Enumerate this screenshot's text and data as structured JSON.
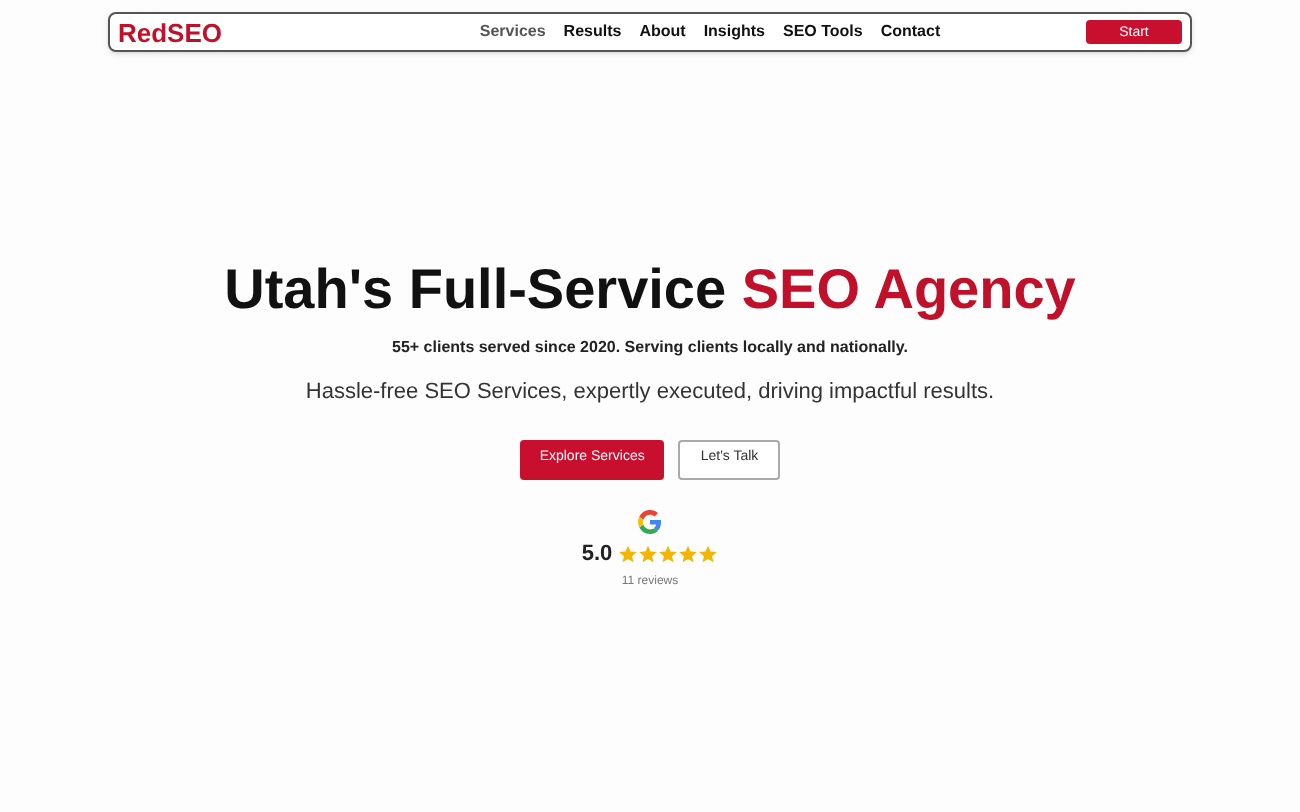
{
  "brand": "RedSEO",
  "nav": [
    {
      "label": "Services",
      "selected": true
    },
    {
      "label": "Results",
      "selected": false
    },
    {
      "label": "About",
      "selected": false
    },
    {
      "label": "Insights",
      "selected": false
    },
    {
      "label": "SEO Tools",
      "selected": false
    },
    {
      "label": "Contact",
      "selected": false
    }
  ],
  "nav_button": "Start",
  "hero": {
    "title": "Utah's Full-Service",
    "title_accent": "SEO Agency",
    "subtitle": "55+ clients served since 2020. Serving clients locally and nationally.",
    "tagline": "Hassle-free SEO Services, expertly executed, driving impactful results.",
    "buttons": [
      {
        "label": "Explore Services",
        "kind": "primary"
      },
      {
        "label": "Let's Talk",
        "kind": "secondary"
      }
    ]
  },
  "rating": {
    "score": "5.0",
    "stars": 5,
    "reviews": "11 reviews"
  }
}
